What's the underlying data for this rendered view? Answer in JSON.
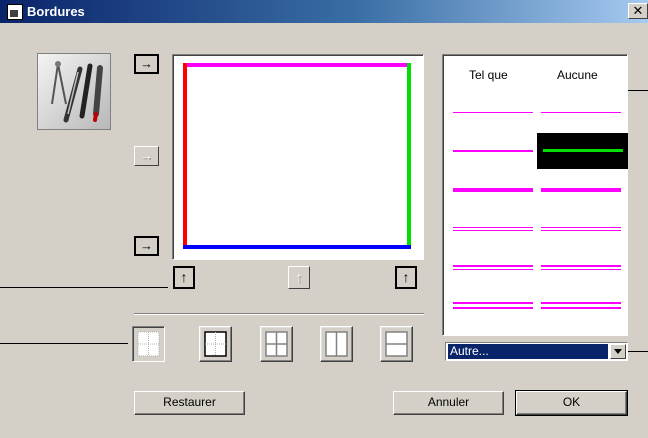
{
  "window": {
    "title": "Bordures",
    "close_symbol": "✕"
  },
  "arrows": {
    "right": "→",
    "up": "↑"
  },
  "styles_panel": {
    "col_left_header": "Tel que",
    "col_right_header": "Aucune",
    "selected_row": 2,
    "selected_column": "Aucune",
    "line_color": "#ff00ff",
    "selected_line_color": "#00e000"
  },
  "preview": {
    "top_border_color": "#ff00ff",
    "left_border_color": "#ff0000",
    "right_border_color": "#00e000",
    "bottom_border_color": "#0000ff"
  },
  "color_select": {
    "value": "Autre..."
  },
  "buttons": {
    "restore": "Restaurer",
    "cancel": "Annuler",
    "ok": "OK"
  }
}
